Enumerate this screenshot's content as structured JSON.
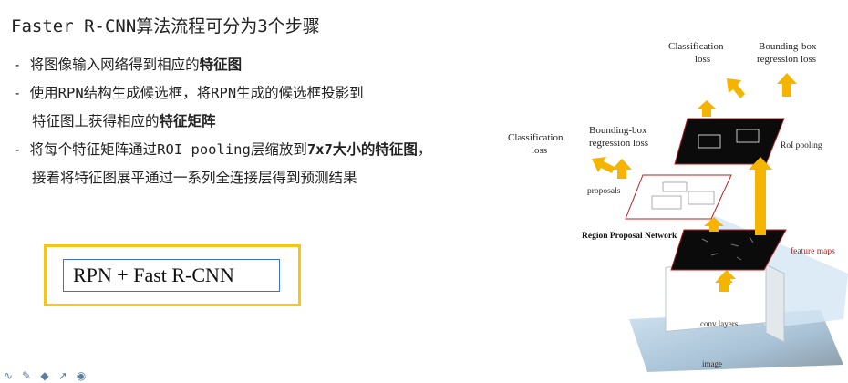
{
  "slide": {
    "title": "Faster R-CNN算法流程可分为3个步骤",
    "bullets": [
      {
        "lines": [
          [
            {
              "t": "- 将图像输入网络得到相应的",
              "b": false
            },
            {
              "t": "特征图",
              "b": true
            }
          ]
        ]
      },
      {
        "lines": [
          [
            {
              "t": "- 使用RPN结构生成候选框，将RPN生成的候选框投影到",
              "b": false
            }
          ],
          [
            {
              "t": "特征图上获得相应的",
              "b": false
            },
            {
              "t": "特征矩阵",
              "b": true
            }
          ]
        ]
      },
      {
        "lines": [
          [
            {
              "t": "- 将每个特征矩阵通过ROI pooling层缩放到",
              "b": false
            },
            {
              "t": "7x7大小的特征图",
              "b": true
            },
            {
              "t": "，",
              "b": false
            }
          ],
          [
            {
              "t": "接着将特征图展平通过一系列全连接层得到预测结果",
              "b": false
            }
          ]
        ]
      }
    ],
    "summary_box": "RPN + Fast R-CNN"
  },
  "diagram": {
    "labels": {
      "cls_top_1": "Classification",
      "cls_top_2": "loss",
      "bbox_top_1": "Bounding-box",
      "bbox_top_2": "regression loss",
      "cls_left_1": "Classification",
      "cls_left_2": "loss",
      "bbox_left_1": "Bounding-box",
      "bbox_left_2": "regression loss",
      "roi_pooling": "RoI pooling",
      "proposals": "proposals",
      "rpn": "Region Proposal Network",
      "feature_maps": "feature maps",
      "conv_layers": "conv layers",
      "image": "image"
    },
    "colors": {
      "arrow": "#f5b400",
      "feature_map": "#0b0b0b",
      "red_accent": "#b22222",
      "box_outline": "#f5c518",
      "box_inner": "#4472c4"
    }
  },
  "toolbar": {
    "icons": [
      "wave-icon",
      "pen-icon",
      "eraser-icon",
      "pointer-icon",
      "target-icon"
    ]
  }
}
